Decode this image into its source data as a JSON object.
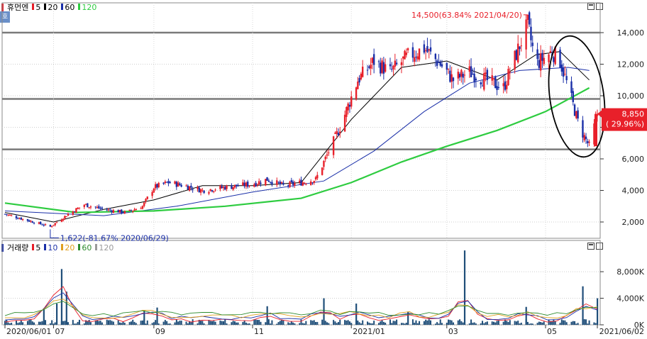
{
  "price_panel": {
    "legend_title": "휴먼엔",
    "ma_labels": [
      "5",
      "20",
      "60",
      "120"
    ],
    "ma_colors": [
      "#e8202a",
      "#000000",
      "#1a2fa8",
      "#2ecc40"
    ],
    "mode_glyph": "호"
  },
  "volume_panel": {
    "legend_title": "거래량",
    "ma_labels": [
      "5",
      "10",
      "20",
      "60",
      "120"
    ],
    "ma_colors": [
      "#e8202a",
      "#1a2fa8",
      "#e0a020",
      "#2e8b2e",
      "#9a9a9a"
    ]
  },
  "annotations": {
    "high": "14,500(63.84% 2021/04/20)",
    "low": "1,622(-81.67% 2020/06/29)"
  },
  "current_price": {
    "value": "8,850",
    "change": "( 29.96%)",
    "color": "#e8202a"
  },
  "chart_data": [
    {
      "type": "candlestick",
      "ylim": [
        1000,
        15000
      ],
      "y_ticks": [
        "14,000",
        "12,000",
        "10,000",
        "8,000",
        "6,000",
        "4,000",
        "2,000"
      ],
      "horizontal_levels": [
        14000,
        9800,
        6600
      ],
      "x_ticks": [
        "2020/06/01",
        "07",
        "09",
        "11",
        "2021/01",
        "03",
        "05",
        "2021/06/02"
      ],
      "close_path": [
        {
          "d": "2020-06-01",
          "v": 2500
        },
        {
          "d": "2020-06-15",
          "v": 2100
        },
        {
          "d": "2020-06-29",
          "v": 1700
        },
        {
          "d": "2020-07-10",
          "v": 2500
        },
        {
          "d": "2020-07-20",
          "v": 3100
        },
        {
          "d": "2020-08-01",
          "v": 2800
        },
        {
          "d": "2020-08-15",
          "v": 2600
        },
        {
          "d": "2020-08-25",
          "v": 3000
        },
        {
          "d": "2020-09-01",
          "v": 4200
        },
        {
          "d": "2020-09-10",
          "v": 4500
        },
        {
          "d": "2020-09-20",
          "v": 4300
        },
        {
          "d": "2020-10-01",
          "v": 4000
        },
        {
          "d": "2020-10-15",
          "v": 4200
        },
        {
          "d": "2020-11-01",
          "v": 4400
        },
        {
          "d": "2020-11-10",
          "v": 4700
        },
        {
          "d": "2020-11-20",
          "v": 4300
        },
        {
          "d": "2020-12-01",
          "v": 4500
        },
        {
          "d": "2020-12-10",
          "v": 4700
        },
        {
          "d": "2020-12-15",
          "v": 5800
        },
        {
          "d": "2020-12-25",
          "v": 8000
        },
        {
          "d": "2021-01-05",
          "v": 11000
        },
        {
          "d": "2021-01-15",
          "v": 12200
        },
        {
          "d": "2021-01-25",
          "v": 11500
        },
        {
          "d": "2021-02-05",
          "v": 12500
        },
        {
          "d": "2021-02-15",
          "v": 13000
        },
        {
          "d": "2021-02-25",
          "v": 12000
        },
        {
          "d": "2021-03-05",
          "v": 11000
        },
        {
          "d": "2021-03-15",
          "v": 11500
        },
        {
          "d": "2021-03-25",
          "v": 11000
        },
        {
          "d": "2021-04-05",
          "v": 10500
        },
        {
          "d": "2021-04-15",
          "v": 13200
        },
        {
          "d": "2021-04-20",
          "v": 14500
        },
        {
          "d": "2021-04-25",
          "v": 12000
        },
        {
          "d": "2021-05-05",
          "v": 12800
        },
        {
          "d": "2021-05-10",
          "v": 12200
        },
        {
          "d": "2021-05-15",
          "v": 10500
        },
        {
          "d": "2021-05-22",
          "v": 8000
        },
        {
          "d": "2021-05-28",
          "v": 6800
        },
        {
          "d": "2021-06-02",
          "v": 8850
        }
      ],
      "ma": {
        "20": [
          {
            "d": "2020-06-01",
            "v": 2600
          },
          {
            "d": "2020-07-01",
            "v": 2000
          },
          {
            "d": "2020-08-01",
            "v": 2800
          },
          {
            "d": "2020-09-01",
            "v": 3400
          },
          {
            "d": "2020-10-01",
            "v": 4300
          },
          {
            "d": "2020-11-01",
            "v": 4300
          },
          {
            "d": "2020-12-01",
            "v": 4500
          },
          {
            "d": "2021-01-01",
            "v": 8500
          },
          {
            "d": "2021-02-01",
            "v": 11800
          },
          {
            "d": "2021-03-01",
            "v": 12200
          },
          {
            "d": "2021-04-01",
            "v": 11000
          },
          {
            "d": "2021-04-25",
            "v": 12600
          },
          {
            "d": "2021-05-10",
            "v": 12800
          },
          {
            "d": "2021-05-28",
            "v": 11000
          }
        ],
        "60": [
          {
            "d": "2020-06-01",
            "v": 2700
          },
          {
            "d": "2020-08-01",
            "v": 2400
          },
          {
            "d": "2020-09-15",
            "v": 3000
          },
          {
            "d": "2020-11-01",
            "v": 3900
          },
          {
            "d": "2020-12-15",
            "v": 4600
          },
          {
            "d": "2021-01-15",
            "v": 6500
          },
          {
            "d": "2021-02-15",
            "v": 9000
          },
          {
            "d": "2021-03-15",
            "v": 10800
          },
          {
            "d": "2021-04-15",
            "v": 11600
          },
          {
            "d": "2021-05-15",
            "v": 11800
          },
          {
            "d": "2021-05-28",
            "v": 11600
          }
        ],
        "120": [
          {
            "d": "2020-06-01",
            "v": 3200
          },
          {
            "d": "2020-07-15",
            "v": 2600
          },
          {
            "d": "2020-09-01",
            "v": 2700
          },
          {
            "d": "2020-10-15",
            "v": 3000
          },
          {
            "d": "2020-12-01",
            "v": 3500
          },
          {
            "d": "2021-01-01",
            "v": 4500
          },
          {
            "d": "2021-02-01",
            "v": 5800
          },
          {
            "d": "2021-03-01",
            "v": 6800
          },
          {
            "d": "2021-04-01",
            "v": 7800
          },
          {
            "d": "2021-05-01",
            "v": 9000
          },
          {
            "d": "2021-05-28",
            "v": 10500
          }
        ]
      }
    },
    {
      "type": "bar",
      "ylim": [
        0,
        11000
      ],
      "y_ticks": [
        "8,000K",
        "4,000K",
        "0K"
      ],
      "peaks": [
        {
          "d": "2020-06-25",
          "v": 2500
        },
        {
          "d": "2020-07-03",
          "v": 3200
        },
        {
          "d": "2020-07-06",
          "v": 8400
        },
        {
          "d": "2020-07-09",
          "v": 5000
        },
        {
          "d": "2020-08-26",
          "v": 2200
        },
        {
          "d": "2020-09-03",
          "v": 2600
        },
        {
          "d": "2020-11-10",
          "v": 2800
        },
        {
          "d": "2020-12-15",
          "v": 4000
        },
        {
          "d": "2021-01-04",
          "v": 3200
        },
        {
          "d": "2021-02-05",
          "v": 2000
        },
        {
          "d": "2021-03-12",
          "v": 11200
        },
        {
          "d": "2021-04-19",
          "v": 2700
        },
        {
          "d": "2021-05-24",
          "v": 5800
        },
        {
          "d": "2021-06-02",
          "v": 4000
        }
      ]
    }
  ]
}
